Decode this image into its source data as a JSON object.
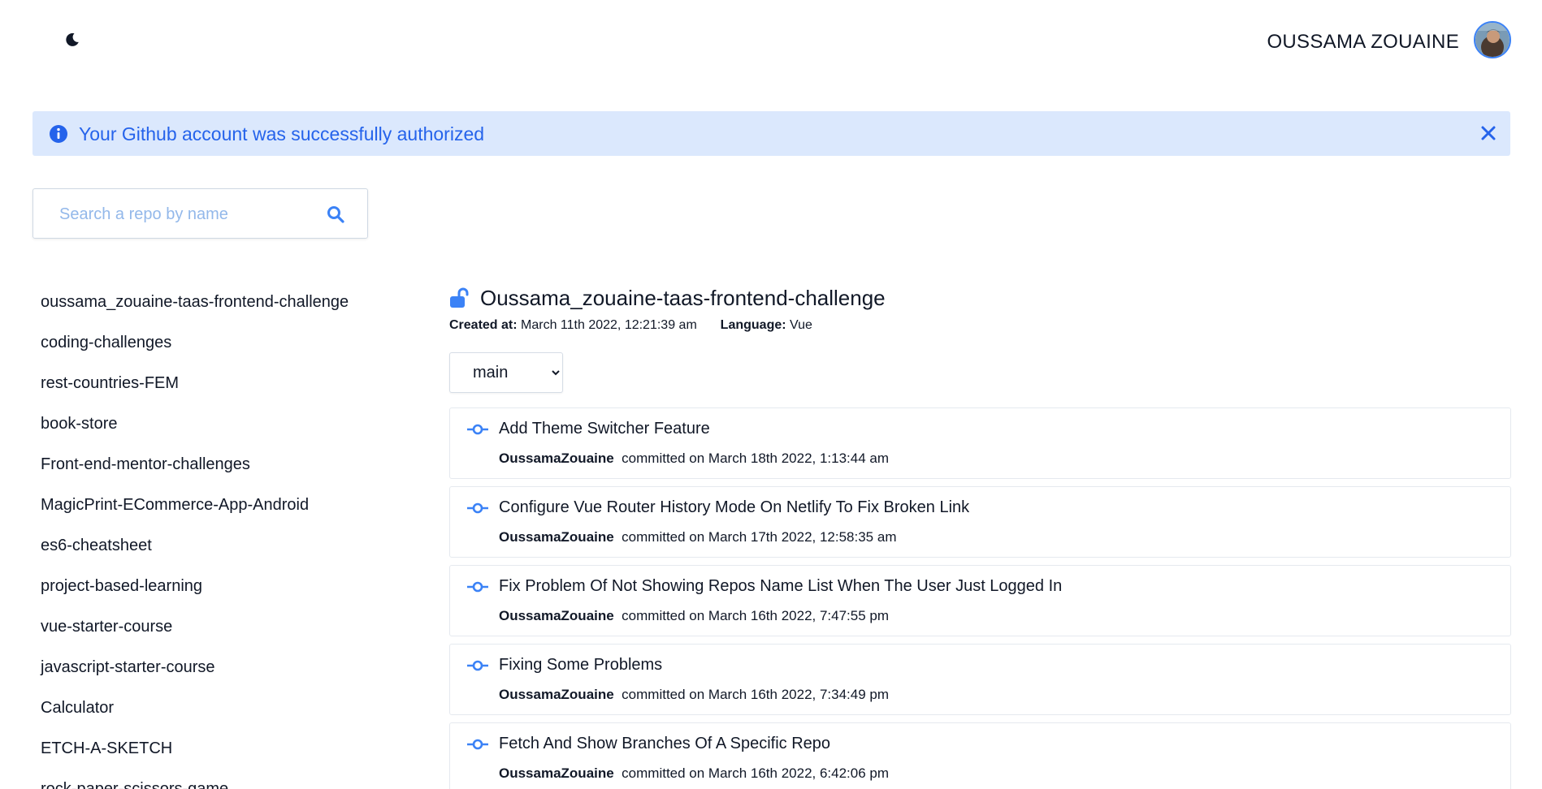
{
  "header": {
    "theme_icon": "moon-icon",
    "user_name": "OUSSAMA ZOUAINE"
  },
  "alert": {
    "message": "Your Github account was successfully authorized",
    "icon": "info-icon",
    "close_icon": "close-icon",
    "color": "#2563eb",
    "background": "#dbe8fd"
  },
  "search": {
    "placeholder": "Search a repo by name",
    "value": ""
  },
  "repos": [
    "oussama_zouaine-taas-frontend-challenge",
    "coding-challenges",
    "rest-countries-FEM",
    "book-store",
    "Front-end-mentor-challenges",
    "MagicPrint-ECommerce-App-Android",
    "es6-cheatsheet",
    "project-based-learning",
    "vue-starter-course",
    "javascript-starter-course",
    "Calculator",
    "ETCH-A-SKETCH",
    "rock-paper-scissors-game"
  ],
  "repo_detail": {
    "title": "Oussama_zouaine-taas-frontend-challenge",
    "created_label": "Created at:",
    "created_value": "March 11th 2022, 12:21:39 am",
    "language_label": "Language:",
    "language_value": "Vue",
    "branch": "main",
    "accent": "#3b82f6"
  },
  "commits": [
    {
      "message": "Add Theme Switcher Feature",
      "author": "OussamaZouaine",
      "when": "committed on March 18th 2022, 1:13:44 am"
    },
    {
      "message": "Configure Vue Router History Mode On Netlify To Fix Broken Link",
      "author": "OussamaZouaine",
      "when": "committed on March 17th 2022, 12:58:35 am"
    },
    {
      "message": "Fix Problem Of Not Showing Repos Name List When The User Just Logged In",
      "author": "OussamaZouaine",
      "when": "committed on March 16th 2022, 7:47:55 pm"
    },
    {
      "message": "Fixing Some Problems",
      "author": "OussamaZouaine",
      "when": "committed on March 16th 2022, 7:34:49 pm"
    },
    {
      "message": "Fetch And Show Branches Of A Specific Repo",
      "author": "OussamaZouaine",
      "when": "committed on March 16th 2022, 6:42:06 pm"
    }
  ]
}
